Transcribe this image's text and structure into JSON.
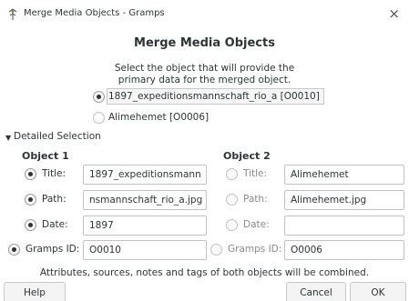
{
  "window": {
    "title": "Merge Media Objects - Gramps",
    "close_glyph": "×"
  },
  "dialog": {
    "heading": "Merge Media Objects",
    "instructions_line1": "Select the object that will provide the",
    "instructions_line2": "primary data for the merged object.",
    "primary_options": [
      {
        "label": "1897_expeditionsmannschaft_rio_a [O0010]",
        "selected": true
      },
      {
        "label": "Alimehemet [O0006]",
        "selected": false
      }
    ],
    "expander_label": "Detailed Selection",
    "object1": {
      "header": "Object 1",
      "title_label": "Title:",
      "title_value": "1897_expeditionsmann",
      "path_label": "Path:",
      "path_value": "nsmannschaft_rio_a.jpg",
      "date_label": "Date:",
      "date_value": "1897",
      "id_label": "Gramps ID:",
      "id_value": "O0010"
    },
    "object2": {
      "header": "Object 2",
      "title_label": "Title:",
      "title_value": "Alimehemet",
      "path_label": "Path:",
      "path_value": "Alimehemet.jpg",
      "date_label": "Date:",
      "date_value": "",
      "id_label": "Gramps ID:",
      "id_value": "O0006"
    },
    "footer_note": "Attributes, sources, notes and tags of both objects will be combined."
  },
  "buttons": {
    "help": "Help",
    "cancel": "Cancel",
    "ok": "OK"
  },
  "icons": {
    "app": "gramps-app-icon",
    "expander": "triangle-down-icon"
  }
}
